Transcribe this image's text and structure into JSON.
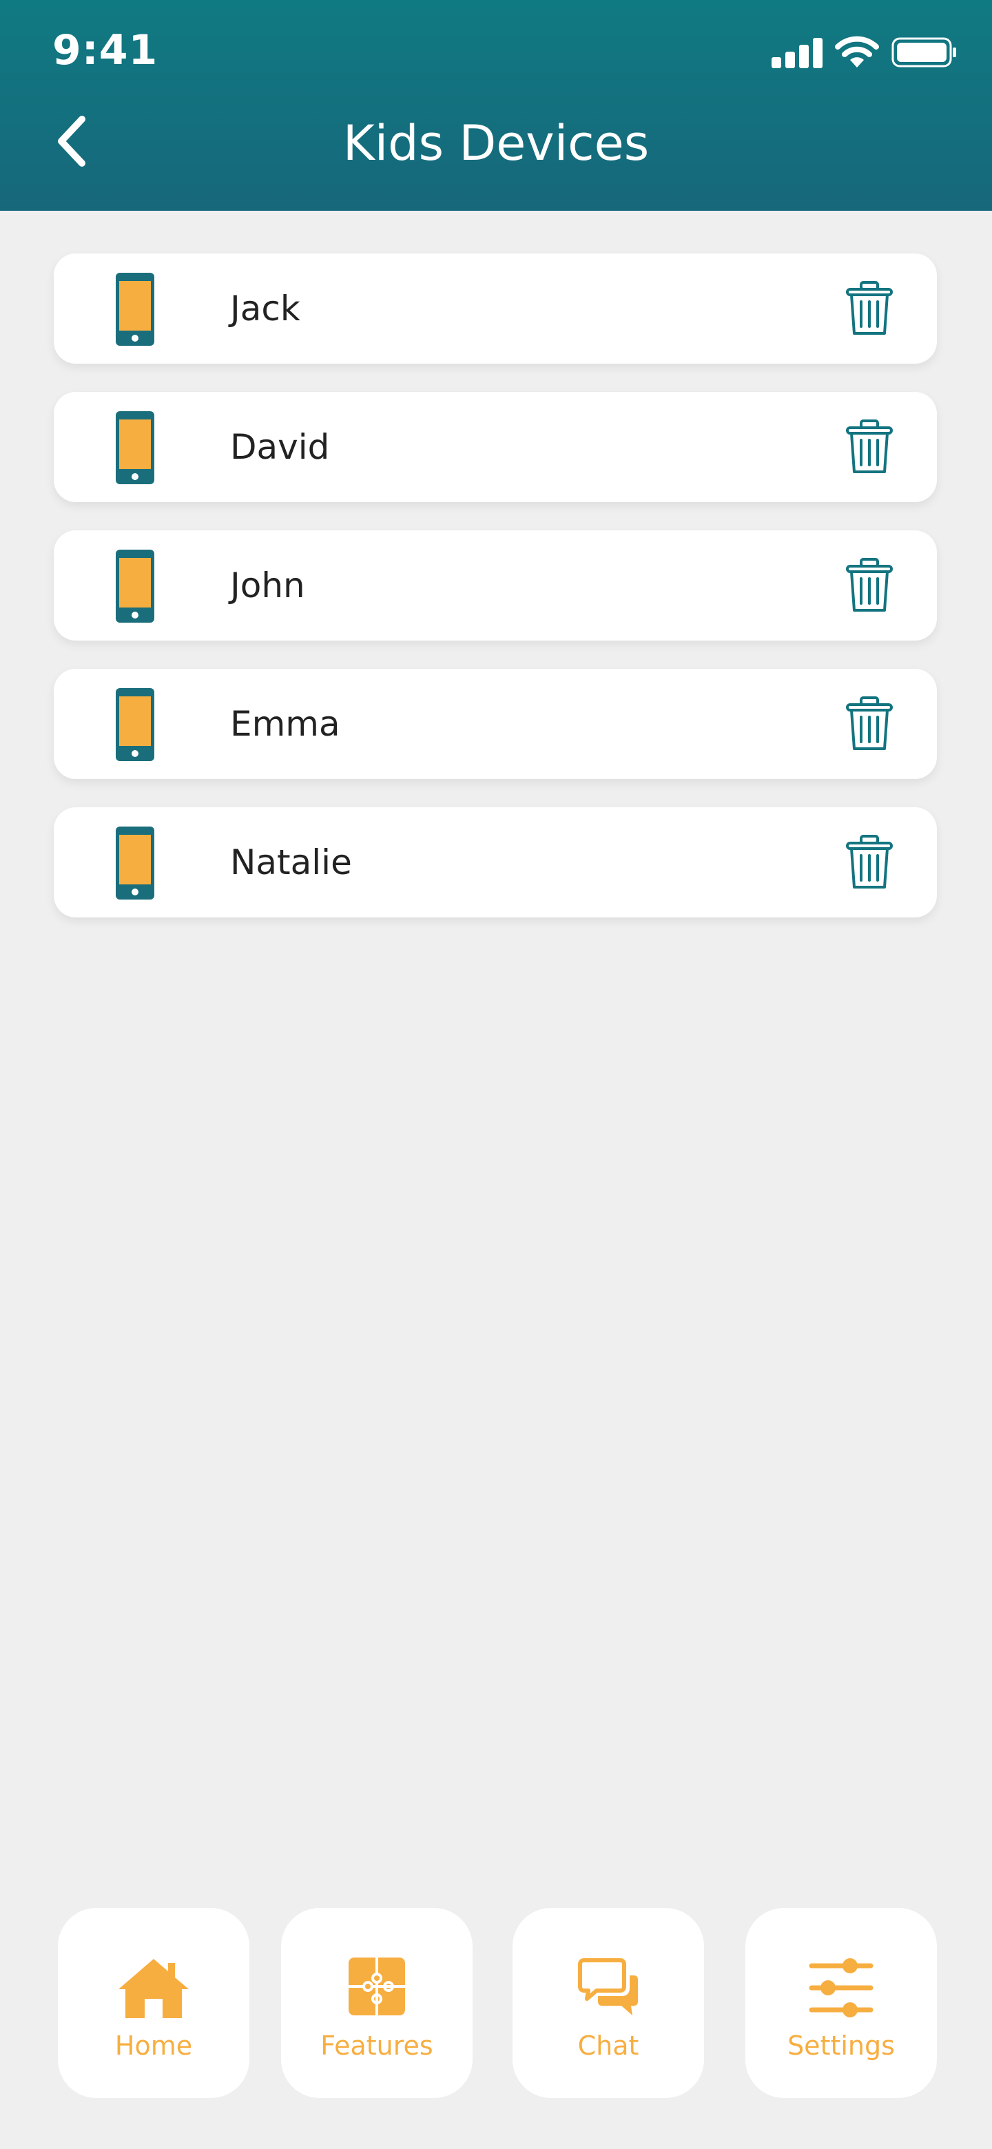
{
  "status": {
    "time": "9:41"
  },
  "header": {
    "title": "Kids Devices"
  },
  "devices": [
    {
      "name": "Jack"
    },
    {
      "name": "David"
    },
    {
      "name": "John"
    },
    {
      "name": "Emma"
    },
    {
      "name": "Natalie"
    }
  ],
  "tabs": [
    {
      "label": "Home",
      "icon": "home-icon"
    },
    {
      "label": "Features",
      "icon": "puzzle-icon"
    },
    {
      "label": "Chat",
      "icon": "chat-icon"
    },
    {
      "label": "Settings",
      "icon": "sliders-icon"
    }
  ],
  "colors": {
    "header": "#137480",
    "accent": "#f7ae40",
    "icon_teal": "#1a6e7c",
    "background": "#efefef"
  }
}
